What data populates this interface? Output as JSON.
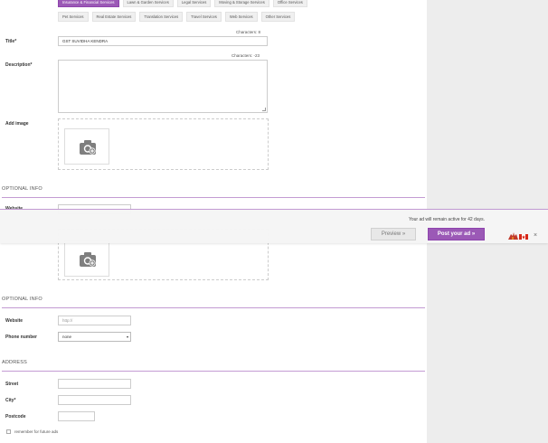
{
  "categories": {
    "row1": [
      {
        "label": "Insurance & Financial Services",
        "selected": true
      },
      {
        "label": "Lawn & Garden Services",
        "selected": false
      },
      {
        "label": "Legal Services",
        "selected": false
      },
      {
        "label": "Moving & Storage Services",
        "selected": false
      },
      {
        "label": "Office Services",
        "selected": false
      }
    ],
    "row2": [
      {
        "label": "Pet Services",
        "selected": false
      },
      {
        "label": "Real Estate Services",
        "selected": false
      },
      {
        "label": "Translation Services",
        "selected": false
      },
      {
        "label": "Travel Services",
        "selected": false
      },
      {
        "label": "Web Services",
        "selected": false
      },
      {
        "label": "Other Services",
        "selected": false
      }
    ]
  },
  "title_field": {
    "label": "Title*",
    "value": "GST SUVIDHA KENDRA",
    "char_count": "Characters: 8"
  },
  "description_field": {
    "label": "Description*",
    "value": "",
    "char_count": "Characters: -23"
  },
  "add_image": {
    "label": "Add image"
  },
  "optional_info_1": {
    "title": "OPTIONAL INFO",
    "partial_label": "Website"
  },
  "optional_info_2": {
    "title": "OPTIONAL INFO",
    "website": {
      "label": "Website",
      "placeholder": "http://"
    },
    "phone": {
      "label": "Phone number",
      "selected": "none"
    }
  },
  "address": {
    "title": "ADDRESS",
    "street": {
      "label": "Street",
      "value": ""
    },
    "city": {
      "label": "City*",
      "value": ""
    },
    "postcode": {
      "label": "Postcode",
      "value": ""
    },
    "remember": {
      "label": "remember for future ads",
      "checked": false
    }
  },
  "sticky_bar": {
    "active_note": "Your ad will remain active for 42 days.",
    "preview_label": "Preview »",
    "post_label": "Post your ad »",
    "flag_icon": "canada-flag-icon",
    "close_label": "×"
  },
  "colors": {
    "accent": "#9b59b6",
    "rule": "#c39bd3",
    "panel": "#ededed"
  }
}
